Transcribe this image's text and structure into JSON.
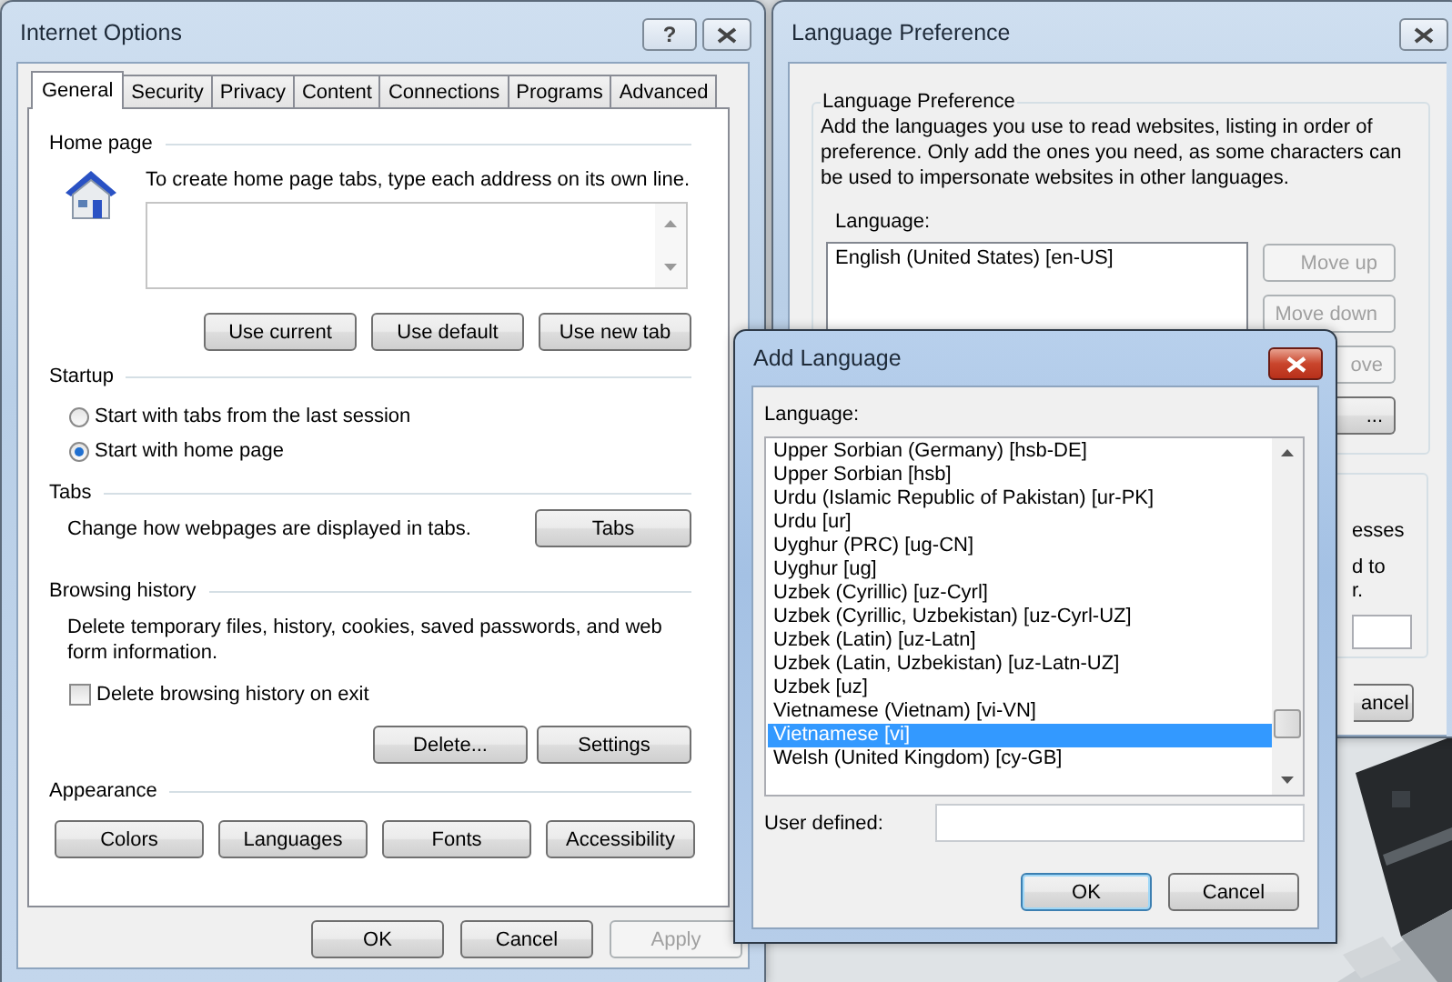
{
  "internet_options": {
    "title": "Internet Options",
    "help_button": "?",
    "tabs": [
      {
        "label": "General",
        "selected": true
      },
      {
        "label": "Security",
        "selected": false
      },
      {
        "label": "Privacy",
        "selected": false
      },
      {
        "label": "Content",
        "selected": false
      },
      {
        "label": "Connections",
        "selected": false
      },
      {
        "label": "Programs",
        "selected": false
      },
      {
        "label": "Advanced",
        "selected": false
      }
    ],
    "home_page": {
      "heading": "Home page",
      "hint": "To create home page tabs, type each address on its own line.",
      "buttons": [
        "Use current",
        "Use default",
        "Use new tab"
      ]
    },
    "startup": {
      "heading": "Startup",
      "options": [
        {
          "label": "Start with tabs from the last session",
          "selected": false
        },
        {
          "label": "Start with home page",
          "selected": true
        }
      ]
    },
    "tabs_section": {
      "heading": "Tabs",
      "text": "Change how webpages are displayed in tabs.",
      "button": "Tabs"
    },
    "browsing_history": {
      "heading": "Browsing history",
      "text": "Delete temporary files, history, cookies, saved passwords, and web form information.",
      "checkbox": {
        "label": "Delete browsing history on exit",
        "checked": false
      },
      "buttons": [
        "Delete...",
        "Settings"
      ]
    },
    "appearance": {
      "heading": "Appearance",
      "buttons": [
        "Colors",
        "Languages",
        "Fonts",
        "Accessibility"
      ]
    },
    "footer_buttons": [
      {
        "label": "OK",
        "disabled": false
      },
      {
        "label": "Cancel",
        "disabled": false
      },
      {
        "label": "Apply",
        "disabled": true
      }
    ]
  },
  "language_preference": {
    "title": "Language Preference",
    "group_heading": "Language Preference",
    "description": "Add the languages you use to read websites, listing in order of preference. Only add the ones you need, as some characters can be used to impersonate websites in other languages.",
    "list_label": "Language:",
    "languages": [
      "English (United States) [en-US]"
    ],
    "side_buttons": [
      {
        "label": "Move up",
        "disabled": true,
        "partly_hidden": false
      },
      {
        "label": "Move down",
        "disabled": true,
        "partly_hidden": false
      },
      {
        "label": "ove",
        "disabled": true,
        "partly_hidden": true
      },
      {
        "label": "...",
        "disabled": false,
        "partly_hidden": true
      }
    ],
    "second_group_lines": [
      "esses",
      "d to",
      "r."
    ],
    "cancel_button": "ancel"
  },
  "add_language": {
    "title": "Add Language",
    "list_label": "Language:",
    "items": [
      {
        "label": "Upper Sorbian (Germany) [hsb-DE]",
        "selected": false
      },
      {
        "label": "Upper Sorbian [hsb]",
        "selected": false
      },
      {
        "label": "Urdu (Islamic Republic of Pakistan) [ur-PK]",
        "selected": false
      },
      {
        "label": "Urdu [ur]",
        "selected": false
      },
      {
        "label": "Uyghur (PRC) [ug-CN]",
        "selected": false
      },
      {
        "label": "Uyghur [ug]",
        "selected": false
      },
      {
        "label": "Uzbek (Cyrillic) [uz-Cyrl]",
        "selected": false
      },
      {
        "label": "Uzbek (Cyrillic, Uzbekistan) [uz-Cyrl-UZ]",
        "selected": false
      },
      {
        "label": "Uzbek (Latin) [uz-Latn]",
        "selected": false
      },
      {
        "label": "Uzbek (Latin, Uzbekistan) [uz-Latn-UZ]",
        "selected": false
      },
      {
        "label": "Uzbek [uz]",
        "selected": false
      },
      {
        "label": "Vietnamese (Vietnam) [vi-VN]",
        "selected": false
      },
      {
        "label": "Vietnamese [vi]",
        "selected": true
      },
      {
        "label": "Welsh (United Kingdom) [cy-GB]",
        "selected": false
      }
    ],
    "user_defined_label": "User defined:",
    "buttons": [
      {
        "label": "OK",
        "default": true
      },
      {
        "label": "Cancel",
        "default": false
      }
    ]
  }
}
